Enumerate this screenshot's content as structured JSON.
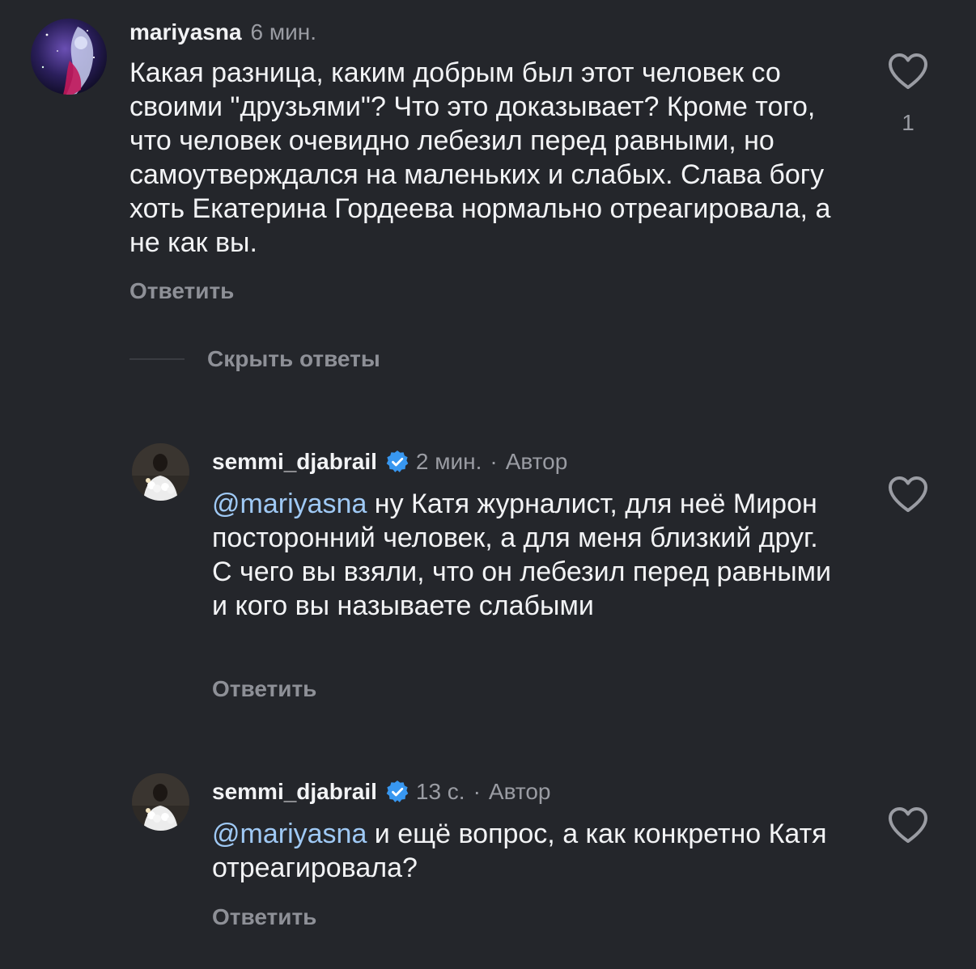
{
  "comments": [
    {
      "username": "mariyasna",
      "time": "6 мин.",
      "text": "Какая разница, каким добрым был этот человек со своими \"друзьями\"? Что это доказывает? Кроме того, что человек очевидно лебезил перед равными, но самоутверждался на маленьких и слабых.  Слава богу хоть Екатерина Гордеева нормально отреагировала, а не как вы.",
      "reply_label": "Ответить",
      "like_count": "1",
      "like_icon": "heart-outline-icon"
    }
  ],
  "hide_replies_label": "Скрыть ответы",
  "replies": [
    {
      "username": "semmi_djabrail",
      "verified": true,
      "time": "2 мин.",
      "separator": "·",
      "author_label": "Автор",
      "mention": "@mariyasna",
      "text": " ну Катя журналист, для неё Мирон посторонний человек, а для меня близкий друг. С чего вы взяли, что он лебезил перед равными и кого вы называете слабыми",
      "reply_label": "Ответить",
      "like_icon": "heart-outline-icon"
    },
    {
      "username": "semmi_djabrail",
      "verified": true,
      "time": "13 с.",
      "separator": "·",
      "author_label": "Автор",
      "mention": "@mariyasna",
      "text": " и ещё вопрос, а как конкретно Катя отреагировала?",
      "reply_label": "Ответить",
      "like_icon": "heart-outline-icon"
    }
  ],
  "colors": {
    "background": "#24262b",
    "mention": "#9fc9f5",
    "verified": "#3897f0",
    "muted": "#9a9ca3"
  }
}
